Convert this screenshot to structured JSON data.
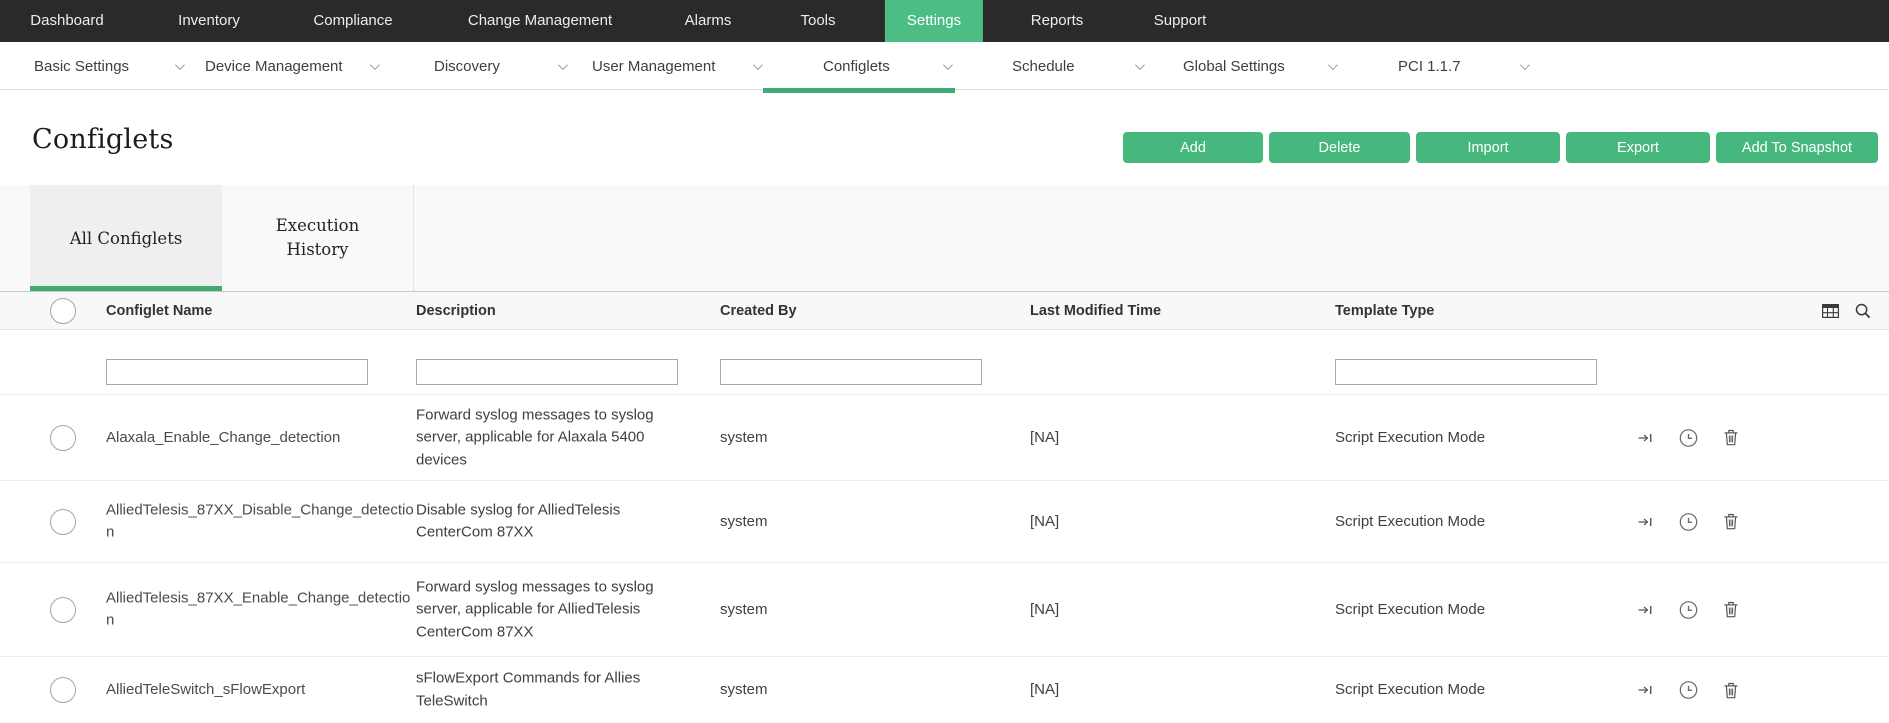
{
  "topnav": {
    "items": [
      {
        "label": "Dashboard"
      },
      {
        "label": "Inventory"
      },
      {
        "label": "Compliance"
      },
      {
        "label": "Change Management"
      },
      {
        "label": "Alarms"
      },
      {
        "label": "Tools"
      },
      {
        "label": "Settings",
        "active": true
      },
      {
        "label": "Reports"
      },
      {
        "label": "Support"
      }
    ]
  },
  "subnav": {
    "items": [
      {
        "label": "Basic Settings"
      },
      {
        "label": "Device Management"
      },
      {
        "label": "Discovery"
      },
      {
        "label": "User Management"
      },
      {
        "label": "Configlets",
        "active": true
      },
      {
        "label": "Schedule"
      },
      {
        "label": "Global Settings"
      },
      {
        "label": "PCI 1.1.7"
      }
    ]
  },
  "page": {
    "title": "Configlets"
  },
  "actions": {
    "buttons": [
      "Add",
      "Delete",
      "Import",
      "Export",
      "Add To Snapshot"
    ]
  },
  "tabs": [
    {
      "label": "All Configlets",
      "active": true
    },
    {
      "label": "Execution History",
      "active": false
    }
  ],
  "table": {
    "columns": [
      "Configlet Name",
      "Description",
      "Created By",
      "Last Modified Time",
      "Template Type"
    ],
    "rows": [
      {
        "name": "Alaxala_Enable_Change_detection",
        "description": "Forward syslog messages to syslog server, applicable for Alaxala 5400 devices",
        "created_by": "system",
        "last_modified": "[NA]",
        "template_type": "Script Execution Mode"
      },
      {
        "name": "AlliedTelesis_87XX_Disable_Change_detection",
        "description": "Disable syslog for AlliedTelesis CenterCom 87XX",
        "created_by": "system",
        "last_modified": "[NA]",
        "template_type": "Script Execution Mode"
      },
      {
        "name": "AlliedTelesis_87XX_Enable_Change_detection",
        "description": "Forward syslog messages to syslog server, applicable for AlliedTelesis CenterCom 87XX",
        "created_by": "system",
        "last_modified": "[NA]",
        "template_type": "Script Execution Mode"
      },
      {
        "name": "AlliedTeleSwitch_sFlowExport",
        "description": "sFlowExport Commands for Allies TeleSwitch",
        "created_by": "system",
        "last_modified": "[NA]",
        "template_type": "Script Execution Mode"
      }
    ]
  },
  "icons": {
    "subnav_item": "chevron-down",
    "header_controls": [
      "column-chooser-grid",
      "search"
    ],
    "row_actions": [
      "apply-to-device",
      "execution-history-clock",
      "delete-trash"
    ]
  },
  "colors": {
    "topnav_bg": "#2a2a2a",
    "accent_green": "#4cbd84",
    "button_green": "#47b87d",
    "underline_green": "#3faa72"
  }
}
